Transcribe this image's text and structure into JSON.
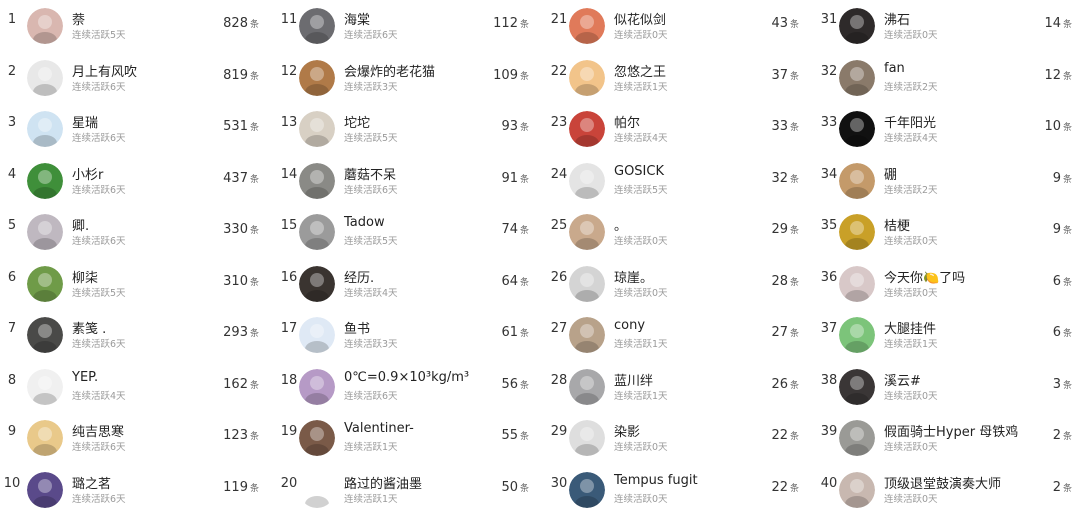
{
  "unit": "条",
  "columns": [
    {
      "rows": [
        {
          "rank": "1",
          "name": "萘",
          "sub": "连续活跃5天",
          "count": "828",
          "avatar": "anime-girl-avatar",
          "color": "#d9b7b0"
        },
        {
          "rank": "2",
          "name": "月上有风吹",
          "sub": "连续活跃6天",
          "count": "819",
          "avatar": "sketch-avatar",
          "color": "#e8e8e8"
        },
        {
          "rank": "3",
          "name": "星瑞",
          "sub": "连续活跃6天",
          "count": "531",
          "avatar": "rain-cloud-avatar",
          "color": "#cfe3f2"
        },
        {
          "rank": "4",
          "name": "小杉r",
          "sub": "连续活跃6天",
          "count": "437",
          "avatar": "green-tree-avatar",
          "color": "#3f8f3a"
        },
        {
          "rank": "5",
          "name": "卿.",
          "sub": "连续活跃6天",
          "count": "330",
          "avatar": "anime-face-avatar",
          "color": "#bfb8c0"
        },
        {
          "rank": "6",
          "name": "柳柒",
          "sub": "连续活跃5天",
          "count": "310",
          "avatar": "leaf-avatar",
          "color": "#6f9b48"
        },
        {
          "rank": "7",
          "name": "素笺 .",
          "sub": "连续活跃6天",
          "count": "293",
          "avatar": "dark-figure-avatar",
          "color": "#4a4a48"
        },
        {
          "rank": "8",
          "name": "YEP.",
          "sub": "连续活跃4天",
          "count": "162",
          "avatar": "ring-avatar",
          "color": "#f0f0f0"
        },
        {
          "rank": "9",
          "name": "纯吉思寒",
          "sub": "连续活跃6天",
          "count": "123",
          "avatar": "mushroom-avatar",
          "color": "#e9c98a"
        },
        {
          "rank": "10",
          "name": "璐之茗",
          "sub": "连续活跃6天",
          "count": "119",
          "avatar": "purple-art-avatar",
          "color": "#5a4a8a"
        }
      ]
    },
    {
      "rows": [
        {
          "rank": "11",
          "name": "海棠",
          "sub": "连续活跃6天",
          "count": "112",
          "avatar": "ink-avatar",
          "color": "#6c6c70"
        },
        {
          "rank": "12",
          "name": "会爆炸的老花猫",
          "sub": "连续活跃3天",
          "count": "109",
          "avatar": "boy-avatar",
          "color": "#b07a48"
        },
        {
          "rank": "13",
          "name": "坨坨",
          "sub": "连续活跃5天",
          "count": "93",
          "avatar": "girl-drawing-avatar",
          "color": "#d8d0c4"
        },
        {
          "rank": "14",
          "name": "蘑菇不呆",
          "sub": "连续活跃6天",
          "count": "91",
          "avatar": "glasses-avatar",
          "color": "#8a8a86"
        },
        {
          "rank": "15",
          "name": "Tadow",
          "sub": "连续活跃5天",
          "count": "74",
          "avatar": "bw-portrait-avatar",
          "color": "#9b9b9b"
        },
        {
          "rank": "16",
          "name": "经历.",
          "sub": "连续活跃4天",
          "count": "64",
          "avatar": "dark-hair-avatar",
          "color": "#3a3430"
        },
        {
          "rank": "17",
          "name": "鱼书",
          "sub": "连续活跃3天",
          "count": "61",
          "avatar": "cartoon-cat-avatar",
          "color": "#dfe9f5"
        },
        {
          "rank": "18",
          "name": "0℃=0.9×10³kg/m³",
          "sub": "连续活跃6天",
          "count": "56",
          "avatar": "pastel-art-avatar",
          "color": "#b69ac6"
        },
        {
          "rank": "19",
          "name": "Valentiner-",
          "sub": "连续活跃1天",
          "count": "55",
          "avatar": "couple-avatar",
          "color": "#7a5a48"
        },
        {
          "rank": "20",
          "name": "路过的酱油墨",
          "sub": "连续活跃1天",
          "count": "50",
          "avatar": "qq-penguin-avatar",
          "color": "#ffffff"
        }
      ]
    },
    {
      "rows": [
        {
          "rank": "21",
          "name": "似花似剑",
          "sub": "连续活跃0天",
          "count": "43",
          "avatar": "red-cartoon-avatar",
          "color": "#e07a5a"
        },
        {
          "rank": "22",
          "name": "忽悠之王",
          "sub": "连续活跃1天",
          "count": "37",
          "avatar": "chibi-avatar",
          "color": "#f2c48a"
        },
        {
          "rank": "23",
          "name": "帕尔",
          "sub": "连续活跃4天",
          "count": "33",
          "avatar": "kid-avatar",
          "color": "#c9443a"
        },
        {
          "rank": "24",
          "name": "GOSICK",
          "sub": "连续活跃5天",
          "count": "32",
          "avatar": "sketch-girl-avatar",
          "color": "#e4e4e4"
        },
        {
          "rank": "25",
          "name": "。",
          "sub": "连续活跃0天",
          "count": "29",
          "avatar": "brown-hair-avatar",
          "color": "#c9a98c"
        },
        {
          "rank": "26",
          "name": "琼崖。",
          "sub": "连续活跃0天",
          "count": "28",
          "avatar": "manga-avatar",
          "color": "#d4d4d4"
        },
        {
          "rank": "27",
          "name": "cony",
          "sub": "连续活跃1天",
          "count": "27",
          "avatar": "anime-boy-avatar",
          "color": "#b8a28a"
        },
        {
          "rank": "28",
          "name": "蓝川绊",
          "sub": "连续活跃1天",
          "count": "26",
          "avatar": "gray-hair-avatar",
          "color": "#a8a8aa"
        },
        {
          "rank": "29",
          "name": "染影",
          "sub": "连续活跃0天",
          "count": "22",
          "avatar": "lineart-avatar",
          "color": "#dedede"
        },
        {
          "rank": "30",
          "name": "Tempus fugit",
          "sub": "连续活跃0天",
          "count": "22",
          "avatar": "blue-crystal-avatar",
          "color": "#3a5a78"
        }
      ]
    },
    {
      "rows": [
        {
          "rank": "31",
          "name": "沸石",
          "sub": "连续活跃0天",
          "count": "14",
          "avatar": "long-hair-avatar",
          "color": "#2e2a2a"
        },
        {
          "rank": "32",
          "name": "fan",
          "sub": "连续活跃2天",
          "count": "12",
          "avatar": "photo-avatar",
          "color": "#8a7a6a"
        },
        {
          "rank": "33",
          "name": "千年阳光",
          "sub": "连续活跃4天",
          "count": "10",
          "avatar": "black-square-avatar",
          "color": "#111111"
        },
        {
          "rank": "34",
          "name": "硼",
          "sub": "连续活跃2天",
          "count": "9",
          "avatar": "warm-photo-avatar",
          "color": "#c49a6a"
        },
        {
          "rank": "35",
          "name": "桔梗",
          "sub": "连续活跃0天",
          "count": "9",
          "avatar": "yellow-avatar",
          "color": "#c9a028"
        },
        {
          "rank": "36",
          "name": "今天你🍋了吗",
          "sub": "连续活跃0天",
          "count": "6",
          "avatar": "soft-girl-avatar",
          "color": "#d8c8c8"
        },
        {
          "rank": "37",
          "name": "大腿挂件",
          "sub": "连续活跃1天",
          "count": "6",
          "avatar": "dino-avatar",
          "color": "#7cc47a"
        },
        {
          "rank": "38",
          "name": "溪云#",
          "sub": "连续活跃0天",
          "count": "3",
          "avatar": "dark-anime-avatar",
          "color": "#3a3636"
        },
        {
          "rank": "39",
          "name": "假面骑士Hyper 母铁鸡",
          "sub": "连续活跃0天",
          "count": "2",
          "avatar": "cat-avatar",
          "color": "#9a9a96"
        },
        {
          "rank": "40",
          "name": "顶级退堂鼓演奏大师",
          "sub": "连续活跃0天",
          "count": "2",
          "avatar": "woman-avatar",
          "color": "#c8b8b0"
        }
      ]
    }
  ]
}
